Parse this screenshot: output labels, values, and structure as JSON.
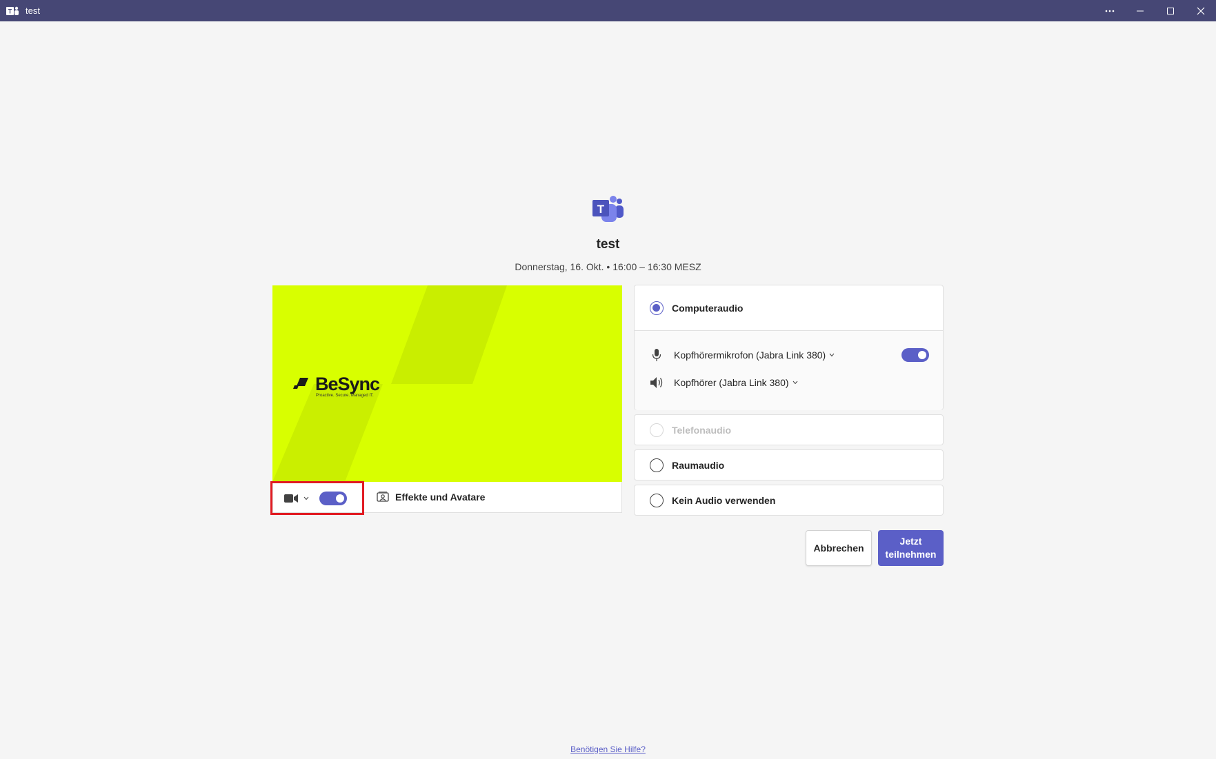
{
  "window": {
    "title": "test",
    "controls": [
      "more-options",
      "minimize",
      "maximize",
      "close"
    ]
  },
  "meeting": {
    "title": "test",
    "datetime": "Donnerstag, 16. Okt. • 16:00 – 16:30 MESZ"
  },
  "video": {
    "background_logo_text": "BeSync",
    "background_logo_tagline": "Proactive. Secure. Managed IT.",
    "camera_on": true,
    "effects_label": "Effekte und Avatare"
  },
  "audio": {
    "computer_audio": {
      "label": "Computeraudio",
      "selected": true
    },
    "microphone": {
      "label": "Kopfhörermikrofon (Jabra Link 380)",
      "enabled": true
    },
    "speaker": {
      "label": "Kopfhörer (Jabra Link 380)"
    },
    "phone_audio": {
      "label": "Telefonaudio",
      "disabled": true
    },
    "room_audio": {
      "label": "Raumaudio"
    },
    "no_audio": {
      "label": "Kein Audio verwenden"
    }
  },
  "actions": {
    "cancel": "Abbrechen",
    "join": "Jetzt teilnehmen"
  },
  "footer": {
    "help": "Benötigen Sie Hilfe?"
  },
  "colors": {
    "titlebar": "#464775",
    "accent": "#5b5fc7",
    "video_bg": "#d8ff00",
    "highlight_box": "#e11b22"
  }
}
